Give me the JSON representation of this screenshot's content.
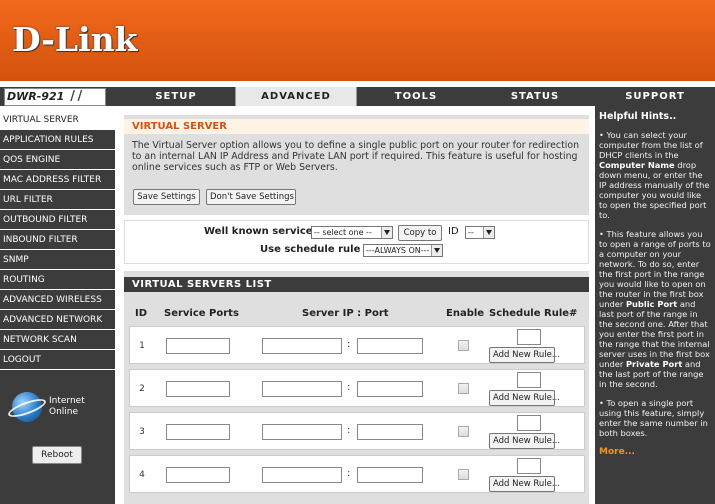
{
  "brand": {
    "logo": "D-Link"
  },
  "header": {
    "model": "DWR-921"
  },
  "nav": {
    "tabs": [
      {
        "label": "SETUP"
      },
      {
        "label": "ADVANCED"
      },
      {
        "label": "TOOLS"
      },
      {
        "label": "STATUS"
      },
      {
        "label": "SUPPORT"
      }
    ],
    "active_tab": "ADVANCED"
  },
  "sidebar": {
    "items": [
      {
        "label": "VIRTUAL SERVER"
      },
      {
        "label": "APPLICATION RULES"
      },
      {
        "label": "QOS ENGINE"
      },
      {
        "label": "MAC ADDRESS FILTER"
      },
      {
        "label": "URL FILTER"
      },
      {
        "label": "OUTBOUND FILTER"
      },
      {
        "label": "INBOUND FILTER"
      },
      {
        "label": "SNMP"
      },
      {
        "label": "ROUTING"
      },
      {
        "label": "ADVANCED WIRELESS"
      },
      {
        "label": "ADVANCED NETWORK"
      },
      {
        "label": "NETWORK SCAN"
      },
      {
        "label": "LOGOUT"
      }
    ],
    "active_item": "VIRTUAL SERVER",
    "internet_label_1": "Internet",
    "internet_label_2": "Online",
    "reboot_label": "Reboot"
  },
  "virtual_server": {
    "title": "VIRTUAL SERVER",
    "description": "The Virtual Server option allows you to define a single public port on your router for redirection to an internal LAN IP Address and Private LAN port if required. This feature is useful for hosting online services such as FTP or Web Servers.",
    "save_label": "Save Settings",
    "dont_save_label": "Don't Save Settings"
  },
  "well_known": {
    "label": "Well known services",
    "select_value": "-- select one --",
    "copy_label": "Copy to",
    "id_label": "ID",
    "id_value": "--",
    "schedule_label": "Use schedule rule",
    "schedule_value": "---ALWAYS ON---"
  },
  "list": {
    "title": "VIRTUAL SERVERS LIST",
    "columns": {
      "id": "ID",
      "ports": "Service Ports",
      "server": "Server IP : Port",
      "enable": "Enable",
      "schedule": "Schedule Rule#"
    },
    "rows": [
      {
        "id": "1",
        "colon": ":",
        "add_rule": "Add New Rule..."
      },
      {
        "id": "2",
        "colon": ":",
        "add_rule": "Add New Rule..."
      },
      {
        "id": "3",
        "colon": ":",
        "add_rule": "Add New Rule..."
      },
      {
        "id": "4",
        "colon": ":",
        "add_rule": "Add New Rule..."
      }
    ]
  },
  "hints": {
    "title": "Helpful Hints..",
    "p1_a": "• You can select your computer from the list of DHCP clients in the ",
    "p1_b": "Computer Name",
    "p1_c": " drop down menu, or enter the IP address manually of the computer you would like to open the specified port to.",
    "p2_a": "• This feature allows you to open a range of ports to a computer on your network. To do so, enter the first port in the range you would like to open on the router in the first box under ",
    "p2_b": "Public Port",
    "p2_c": " and last port of the range in the second one. After that you enter the first port in the range that the internal server uses in the first box under ",
    "p2_d": "Private Port",
    "p2_e": " and the last port of the range in the second.",
    "p3": "• To open a single port using this feature, simply enter the same number in both boxes.",
    "more": "More..."
  }
}
